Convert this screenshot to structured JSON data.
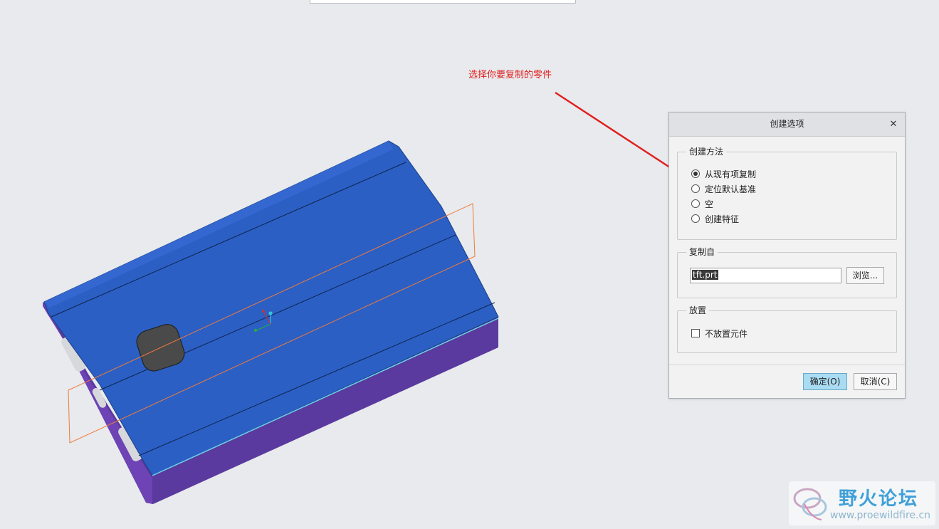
{
  "annotation": {
    "text": "选择你要复制的零件",
    "color": "#e0201e"
  },
  "model": {
    "top_color": "#2b5fc4",
    "side_color": "#5b3aa2",
    "plane_color": "#f07a3a"
  },
  "dialog": {
    "title": "创建选项",
    "close_icon": "close-icon",
    "method_group": {
      "legend": "创建方法",
      "options": [
        {
          "label": "从现有项复制",
          "selected": true
        },
        {
          "label": "定位默认基准",
          "selected": false
        },
        {
          "label": "空",
          "selected": false
        },
        {
          "label": "创建特征",
          "selected": false
        }
      ]
    },
    "copy_group": {
      "legend": "复制自",
      "file_value": "tft.prt",
      "browse_label": "浏览..."
    },
    "place_group": {
      "legend": "放置",
      "checkbox_label": "不放置元件",
      "checked": false
    },
    "ok_label": "确定(O)",
    "cancel_label": "取消(C)"
  },
  "watermark": {
    "title": "野火论坛",
    "url": "www.proewildfire.cn"
  }
}
